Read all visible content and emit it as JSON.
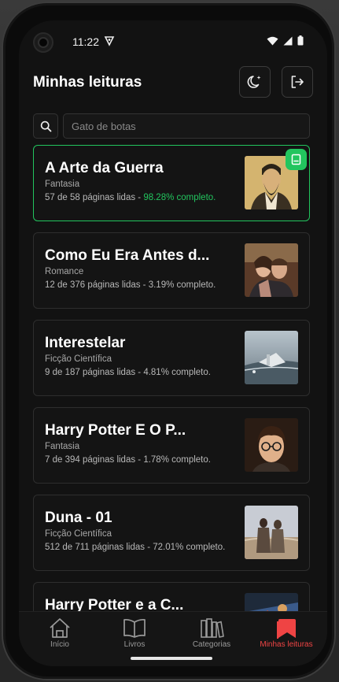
{
  "status_bar": {
    "time": "11:22"
  },
  "header": {
    "title": "Minhas leituras",
    "theme_icon": "moon-sparkle-icon",
    "logout_icon": "logout-icon"
  },
  "search": {
    "placeholder": "Gato de botas",
    "value": ""
  },
  "books": [
    {
      "title": "A Arte da Guerra",
      "genre": "Fantasia",
      "progress_prefix": "57 de 58 páginas lidas - ",
      "progress_percent": "98.28% completo.",
      "highlight": true
    },
    {
      "title": "Como Eu Era Antes d...",
      "genre": "Romance",
      "progress_prefix": "12 de 376 páginas lidas - ",
      "progress_percent": "3.19% completo.",
      "highlight": false
    },
    {
      "title": "Interestelar",
      "genre": "Ficção Científica",
      "progress_prefix": "9 de 187 páginas lidas - ",
      "progress_percent": "4.81% completo.",
      "highlight": false
    },
    {
      "title": "Harry Potter E O P...",
      "genre": "Fantasia",
      "progress_prefix": "7 de 394 páginas lidas - ",
      "progress_percent": "1.78% completo.",
      "highlight": false
    },
    {
      "title": "Duna - 01",
      "genre": "Ficção Científica",
      "progress_prefix": "512 de 711 páginas lidas - ",
      "progress_percent": "72.01% completo.",
      "highlight": false
    },
    {
      "title": "Harry Potter e a C...",
      "genre": "",
      "progress_prefix": "",
      "progress_percent": "",
      "highlight": false
    }
  ],
  "nav": {
    "items": [
      {
        "label": "Início",
        "icon": "home-icon"
      },
      {
        "label": "Livros",
        "icon": "open-book-icon"
      },
      {
        "label": "Categorias",
        "icon": "library-icon"
      },
      {
        "label": "Minhas leituras",
        "icon": "bookmark-icon"
      }
    ],
    "active": "Minhas leituras"
  },
  "colors": {
    "accent_green": "#22c55e",
    "accent_red": "#ef4444",
    "background": "#121212"
  }
}
